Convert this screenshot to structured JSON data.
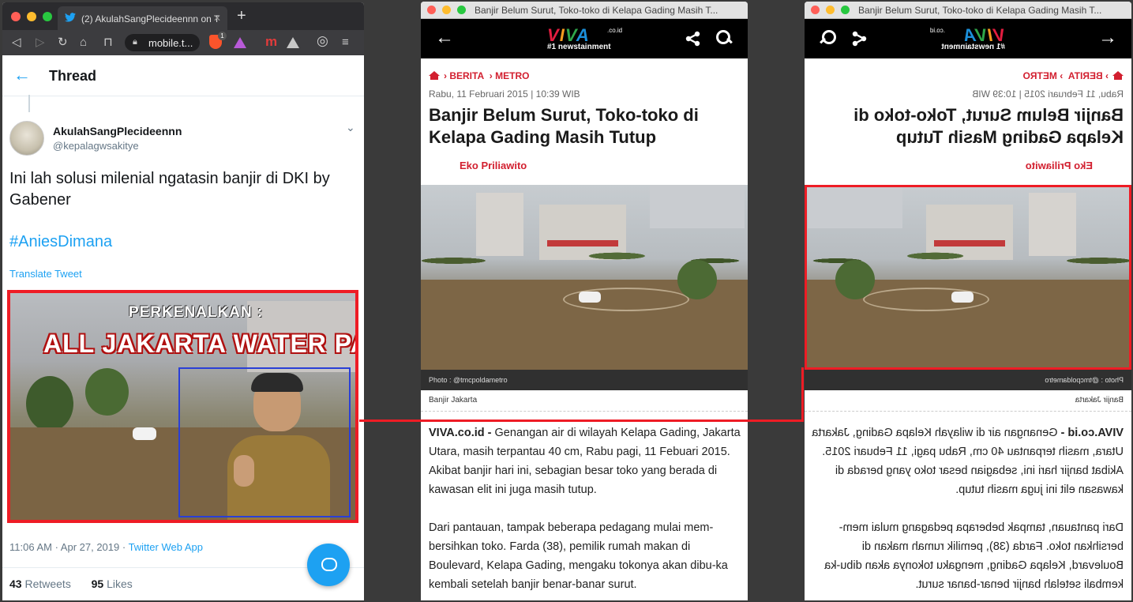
{
  "window1": {
    "tab_title": "(2) AkulahSangPlecideennn on T",
    "address": "mobile.t...",
    "tweet": {
      "header_title": "Thread",
      "display_name": "AkulahSangPlecideennn",
      "handle": "@kepalagwsakitye",
      "text": "Ini lah solusi milenial ngatasin banjir di DKI by Gabener",
      "hashtag": "#AniesDimana",
      "translate": "Translate Tweet",
      "image_text_1": "PERKENALKAN :",
      "image_text_2": "ALL JAKARTA WATER PARK",
      "timestamp": "11:06 AM · Apr 27, 2019 · ",
      "source": "Twitter Web App",
      "retweets_count": "43",
      "retweets_label": " Retweets",
      "likes_count": "95",
      "likes_label": " Likes"
    }
  },
  "article": {
    "window_title": "Banjir Belum Surut, Toko-toko di Kelapa Gading Masih T...",
    "logo": "VIVA",
    "logo_domain": ".co.id",
    "logo_tagline": "#1 newstainment",
    "breadcrumb_1": "BERITA",
    "breadcrumb_2": "METRO",
    "date": "Rabu, 11 Februari 2015 | 10:39 WIB",
    "headline": "Banjir Belum Surut, Toko-toko di Kelapa Gading Masih Tutup",
    "author": "Eko Priliawito",
    "photo_caption": "Photo : @tmcpoldametro",
    "tag": "Banjir Jakarta",
    "lead_bold": "VIVA.co.id - ",
    "paragraph_1": "Genangan air di wilayah Kelapa Gading, Jakarta Utara, masih terpantau 40 cm, Rabu pagi, 11 Febuari 2015. Akibat banjir hari ini, sebagian besar toko yang berada di kawasan elit ini juga masih tutup.",
    "paragraph_2": "Dari pantauan, tampak beberapa pedagang mulai mem-bersihkan toko. Farda (38), pemilik rumah makan di Boulevard, Kelapa Gading, mengaku tokonya akan dibu-ka kembali setelah banjir benar-banar surut."
  },
  "window3_title": "Banjir Belum Surut, Toko-toko di Kelapa Gading Masih T...",
  "colors": {
    "highlight_red": "#ee1c25",
    "twitter_blue": "#1da1f2",
    "viva_red": "#d21f2f",
    "person_box_blue": "#2a3fd6"
  }
}
